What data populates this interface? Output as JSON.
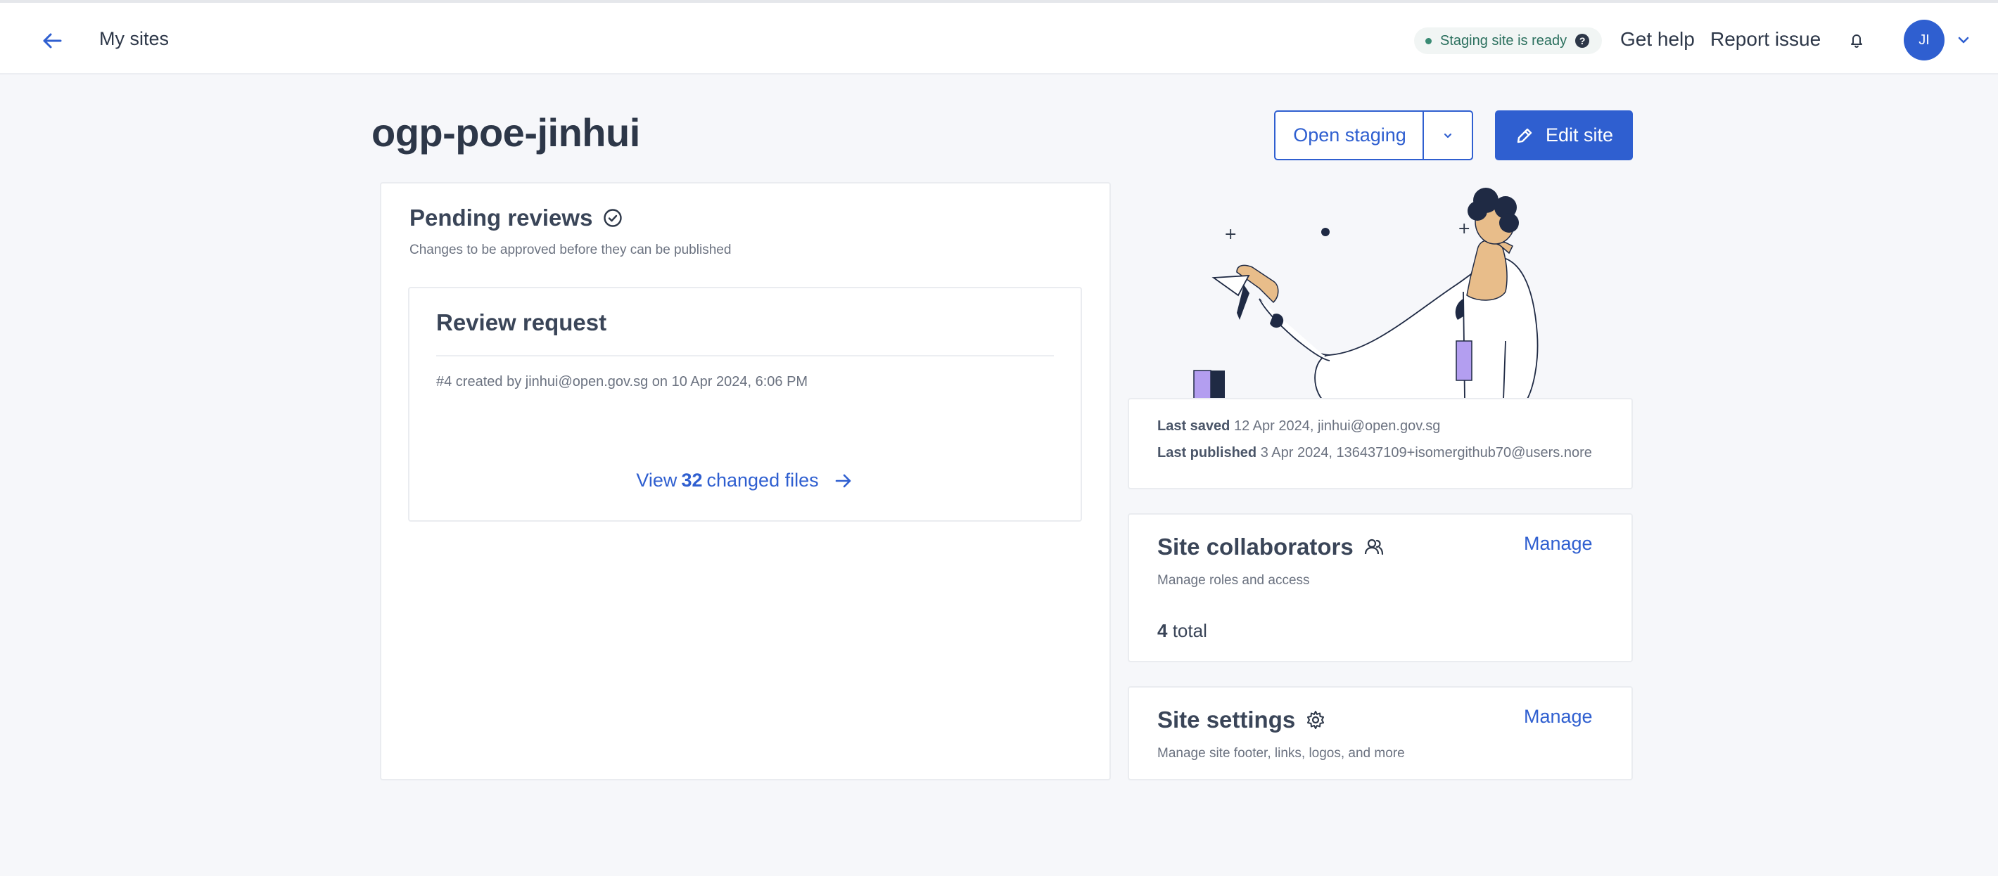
{
  "header": {
    "my_sites": "My sites",
    "staging_status": "Staging site is ready",
    "help_mark": "?",
    "get_help": "Get help",
    "report_issue": "Report issue",
    "avatar_initials": "JI"
  },
  "site": {
    "name": "ogp-poe-jinhui",
    "open_staging": "Open staging",
    "edit_site": "Edit site"
  },
  "pending_reviews": {
    "title": "Pending reviews",
    "subtitle": "Changes to be approved before they can be published",
    "request": {
      "title": "Review request",
      "meta": "#4 created by jinhui@open.gov.sg on 10 Apr 2024, 6:06 PM",
      "view_prefix": "View",
      "changed_count": "32",
      "view_suffix": "changed files"
    }
  },
  "activity": {
    "last_saved_label": "Last saved",
    "last_saved_value": "12 Apr 2024, jinhui@open.gov.sg",
    "last_published_label": "Last published",
    "last_published_value": "3 Apr 2024, 136437109+isomergithub70@users.nore"
  },
  "collaborators": {
    "title": "Site collaborators",
    "subtitle": "Manage roles and access",
    "manage": "Manage",
    "count": "4",
    "count_suffix": "total"
  },
  "settings": {
    "title": "Site settings",
    "subtitle": "Manage site footer, links, logos, and more",
    "manage": "Manage"
  },
  "colors": {
    "primary": "#2f5fd0",
    "success_text": "#2a6f5d",
    "background": "#f6f7fa"
  }
}
